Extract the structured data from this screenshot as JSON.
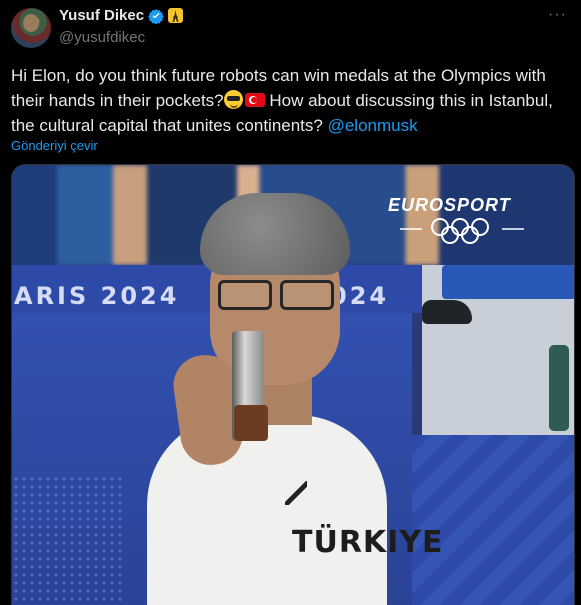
{
  "author": {
    "display_name": "Yusuf Dikec",
    "handle": "@yusufdikec",
    "verified": true,
    "affiliate_badge_icon": "eiffel-tower-icon"
  },
  "tweet": {
    "text_before_emoji": "Hi Elon, do you think future robots can win medals at the Olympics with their hands in their pockets?",
    "text_after_emoji": " How about discussing this in Istanbul, the cultural capital that unites continents? ",
    "mention": "@elonmusk",
    "emojis": [
      "smiling-face-with-sunglasses",
      "turkey-flag"
    ],
    "translate_label": "Gönderiyi çevir"
  },
  "media": {
    "broadcaster_logo": "EUROSPORT",
    "banner_left": "ARIS 2024",
    "banner_right": "024",
    "jersey_text": "TÜRKIYE"
  },
  "colors": {
    "background": "#000000",
    "text": "#e7e9ea",
    "secondary": "#71767b",
    "accent": "#1d9bf0"
  }
}
